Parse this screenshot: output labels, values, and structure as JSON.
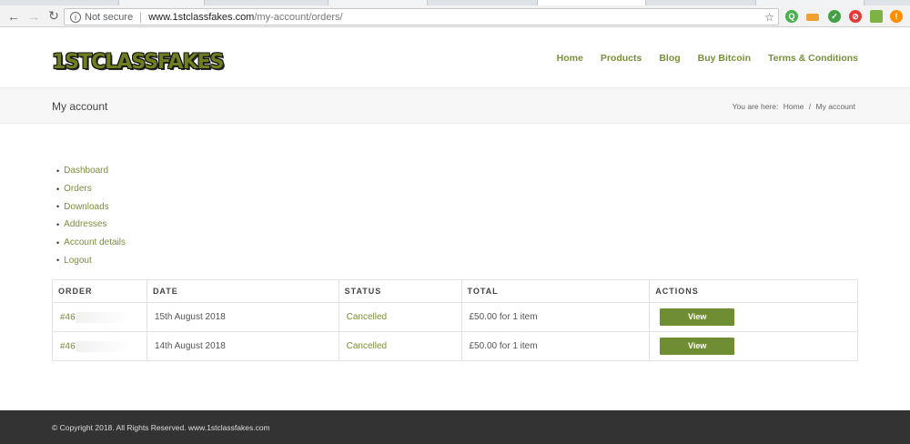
{
  "browser": {
    "security_label": "Not secure",
    "url_host": "www.1stclassfakes.com",
    "url_path": "/my-account/orders/"
  },
  "site": {
    "logo_text": "1STCLASSFAKES",
    "nav": [
      "Home",
      "Products",
      "Blog",
      "Buy Bitcoin",
      "Terms & Conditions"
    ]
  },
  "titlebar": {
    "title": "My account",
    "breadcrumb_prefix": "You are here:",
    "breadcrumb_home": "Home",
    "breadcrumb_sep": "/",
    "breadcrumb_current": "My account"
  },
  "account_nav": [
    "Dashboard",
    "Orders",
    "Downloads",
    "Addresses",
    "Account details",
    "Logout"
  ],
  "orders_table": {
    "headers": [
      "ORDER",
      "DATE",
      "STATUS",
      "TOTAL",
      "ACTIONS"
    ],
    "rows": [
      {
        "order": "#46",
        "date": "15th August 2018",
        "status": "Cancelled",
        "total": "£50.00 for 1 item",
        "action": "View"
      },
      {
        "order": "#46",
        "date": "14th August 2018",
        "status": "Cancelled",
        "total": "£50.00 for 1 item",
        "action": "View"
      }
    ]
  },
  "footer": {
    "copyright": "© Copyright 2018. All Rights Reserved. www.1stclassfakes.com"
  },
  "colors": {
    "accent": "#7a8f3a",
    "button": "#6f8d33",
    "footer_bg": "#333333"
  }
}
